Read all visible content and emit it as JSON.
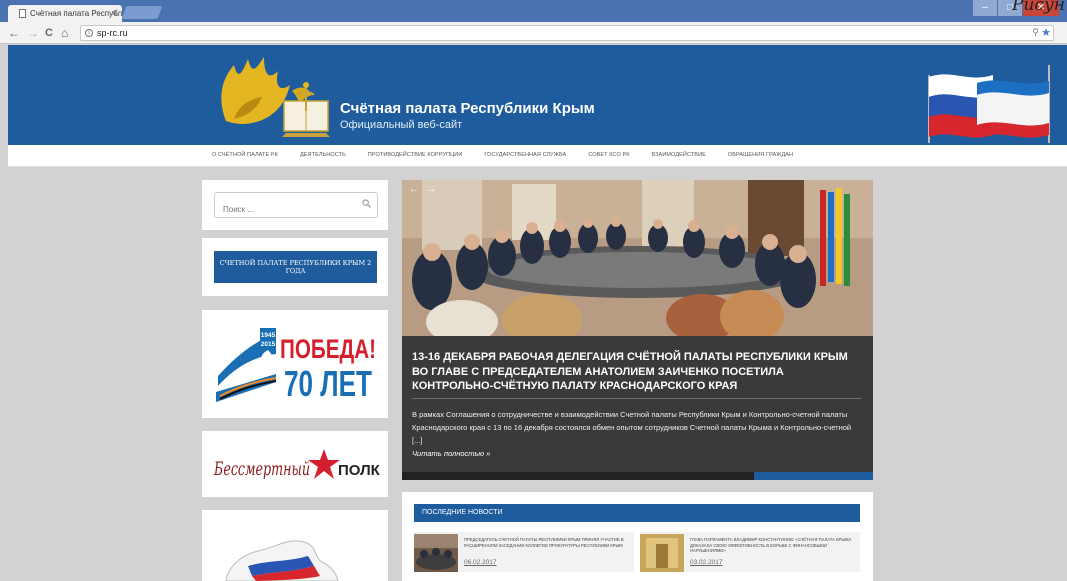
{
  "browser": {
    "tab_title": "Счётная палата Республ",
    "tab_close": "×",
    "url": "sp-rc.ru",
    "corner_text": "Рисун",
    "zoom_glyph": "⚲",
    "star_glyph": "★",
    "menu_glyph": "⋮",
    "back_glyph": "←",
    "forward_glyph": "→",
    "reload_glyph": "C",
    "home_glyph": "⌂",
    "min_glyph": "–",
    "max_glyph": "□",
    "close_glyph": "✕"
  },
  "header": {
    "title": "Счётная палата Республики Крым",
    "subtitle": "Официальный веб-сайт"
  },
  "nav": {
    "items": [
      "О СЧЁТНОЙ ПАЛАТЕ РК",
      "ДЕЯТЕЛЬНОСТЬ",
      "ПРОТИВОДЕЙСТВИЕ КОРРУПЦИИ",
      "ГОСУДАРСТВЕННАЯ СЛУЖБА",
      "СОВЕТ КСО РК",
      "ВЗАИМОДЕЙСТВИЕ",
      "ОБРАЩЕНИЯ ГРАЖДАН"
    ]
  },
  "sidebar": {
    "search_placeholder": "Поиск ...",
    "anniversary_label": "СЧЕТНОЙ ПАЛАТЕ РЕСПУБЛИКИ КРЫМ 2 ГОДА",
    "victory": {
      "years_top": "1945",
      "years_bottom": "2015",
      "line1": "ПОБЕДА!",
      "line2": "70 ЛЕТ"
    },
    "polk": {
      "script": "Бессмертный",
      "word": "ПОЛК"
    }
  },
  "slider": {
    "prev": "←",
    "next": "→",
    "title": "13-16 декабря рабочая делегация Счётной палаты Республики Крым во главе с Председателем Анатолием Заиченко посетила Контрольно-счётную палату Краснодарского края",
    "text": "В рамках Соглашения о сотрудничестве и взаимодействии Счетной палаты Республики Крым и Контрольно-счетной палаты Краснодарского края с 13 по 16 декабря состоялся обмен опытом сотрудников Счетной палаты Крыма и Контрольно-счетной [...]",
    "read_more": "Читать полностью »"
  },
  "news": {
    "header": "Последние новости",
    "items": [
      {
        "title": "Председатель Счетной палаты Республики Крым принял участие в расширенном заседании коллегии прокуратуры Республики Крым",
        "date": "06.02.2017"
      },
      {
        "title": "Глава Парламента Владимир Константинов: «Счётная палата Крыма доказала свою эффективность в борьбе с финансовыми нарушениями»",
        "date": "03.02.2017"
      }
    ]
  },
  "colors": {
    "brand": "#1e5c9e",
    "page_bg": "#d2d2d2",
    "caption_bg": "#3a3a3a",
    "victory_red": "#d3202c",
    "victory_blue": "#1a6fb4"
  }
}
